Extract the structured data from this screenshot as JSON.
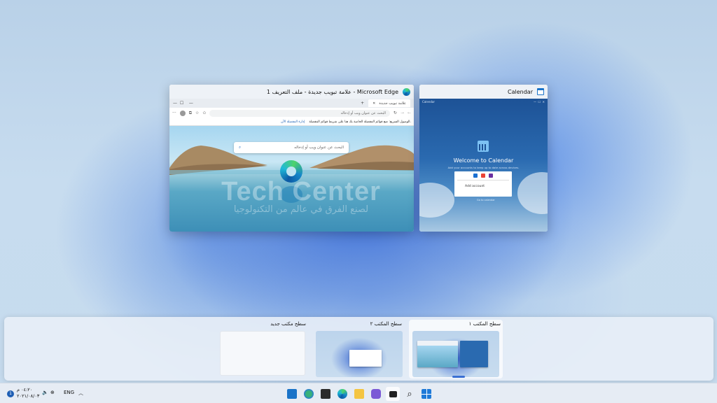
{
  "edge_window": {
    "title": "علامة تبويب جديدة - ملف التعريف 1 - Microsoft Edge",
    "tab_label": "علامة تبويب جديدة",
    "address_placeholder": "البحث عن عنوان ويب أو إدخاله",
    "favbar_text": "الوصول السريع: ضع قوائم المفضلة الخاصة بك هنا على شريط قوائم المفضلة.",
    "favbar_link": "إدارة المفضلة الآن",
    "hero_search_placeholder": "البحث عن عنوان ويب أو إدخاله"
  },
  "watermark": {
    "title": "Tech Center",
    "subtitle": "لصنع الفرق في عالم من التكنولوجيا"
  },
  "calendar_window": {
    "title": "Calendar",
    "inner_title": "Calendar",
    "welcome": "Welcome to Calendar",
    "subtitle": "Add your accounts to keep up to date across devices.",
    "add_account": "Add account",
    "link": "Go to calendar"
  },
  "desktops": [
    {
      "label": "سطح مكتب جديد"
    },
    {
      "label": "سطح المكتب ٢"
    },
    {
      "label": "سطح المكتب ١",
      "active": true
    }
  ],
  "taskbar": {
    "apps": [
      "calendar-app",
      "maps-app",
      "store-app",
      "edge-app",
      "file-explorer-app",
      "chat-app",
      "task-view-app",
      "search-app",
      "start-app"
    ],
    "language": "ENG",
    "time": "٠٤:٢٠ م",
    "date": "٢٠٢١/٠٨/٠٣",
    "notification_count": "1"
  },
  "colors": {
    "accent": "#3a6fd3",
    "edge_blue": "#0c59a4",
    "calendar_blue": "#1d5296"
  }
}
